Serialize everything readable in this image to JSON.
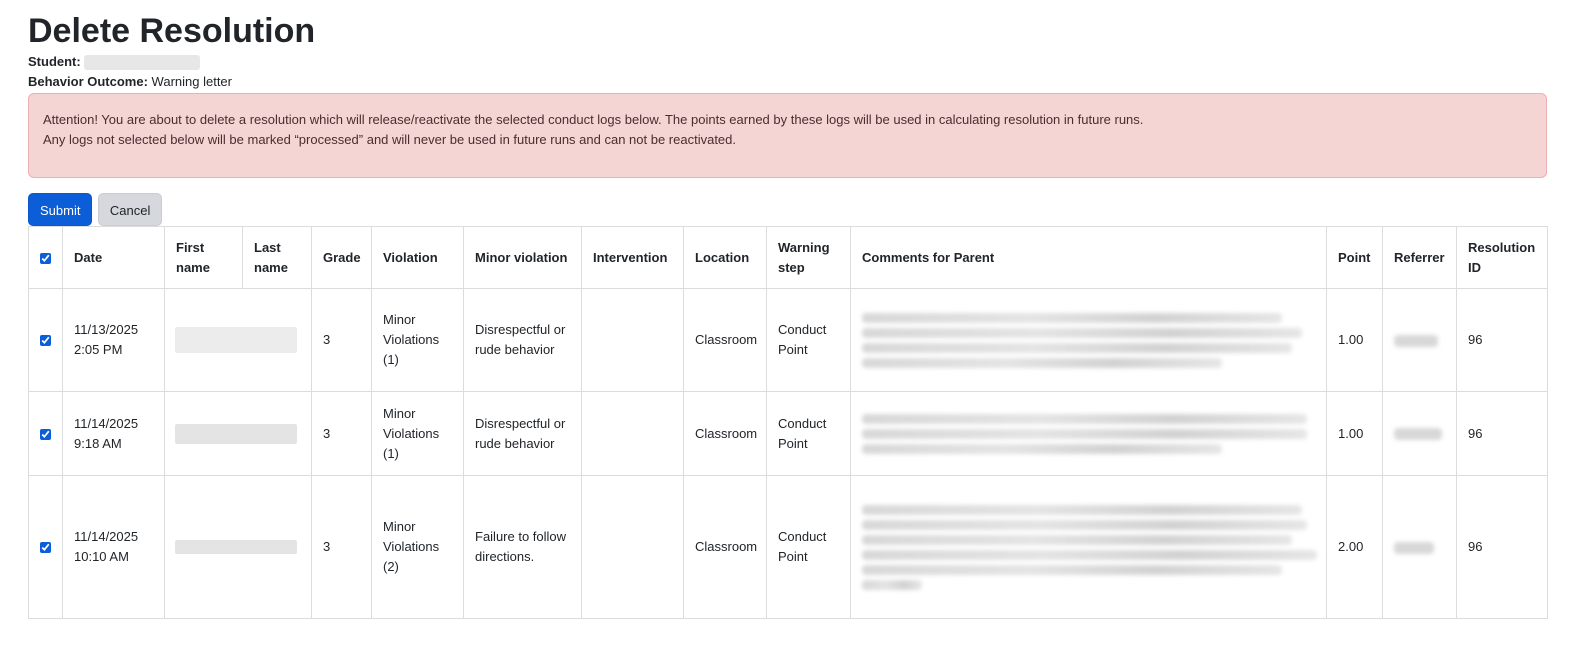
{
  "page": {
    "title": "Delete Resolution",
    "student_label": "Student:",
    "behavior_outcome_label": "Behavior Outcome:",
    "behavior_outcome_value": "Warning letter"
  },
  "alert": {
    "line1": "Attention! You are about to delete a resolution which will release/reactivate the selected conduct logs below. The points earned by these logs will be used in calculating resolution in future runs.",
    "line2": "Any logs not selected below will be marked “processed” and will never be used in future runs and can not be reactivated."
  },
  "actions": {
    "submit_label": "Submit",
    "cancel_label": "Cancel"
  },
  "table": {
    "headers": {
      "date": "Date",
      "first_name": "First name",
      "last_name": "Last name",
      "grade": "Grade",
      "violation": "Violation",
      "minor_violation": "Minor violation",
      "intervention": "Intervention",
      "location": "Location",
      "warning_step": "Warning step",
      "comments": "Comments for Parent",
      "point": "Point",
      "referrer": "Referrer",
      "resolution_id": "Resolution ID"
    },
    "rows": [
      {
        "date": "11/13/2025",
        "time": "2:05 PM",
        "grade": "3",
        "violation": "Minor Violations (1)",
        "minor_violation": "Disrespectful or rude behavior",
        "intervention": "",
        "location": "Classroom",
        "warning_step": "Conduct Point",
        "point": "1.00",
        "resolution_id": "96",
        "checked": true
      },
      {
        "date": "11/14/2025",
        "time": "9:18 AM",
        "grade": "3",
        "violation": "Minor Violations (1)",
        "minor_violation": "Disrespectful or rude behavior",
        "intervention": "",
        "location": "Classroom",
        "warning_step": "Conduct Point",
        "point": "1.00",
        "resolution_id": "96",
        "checked": true
      },
      {
        "date": "11/14/2025",
        "time": "10:10 AM",
        "grade": "3",
        "violation": "Minor Violations (2)",
        "minor_violation": "Failure to follow directions.",
        "intervention": "",
        "location": "Classroom",
        "warning_step": "Conduct Point",
        "point": "2.00",
        "resolution_id": "96",
        "checked": true
      }
    ]
  },
  "colors": {
    "primary": "#0b5ed7",
    "alert_bg": "#f5d4d4",
    "alert_border": "#eab1b3"
  }
}
